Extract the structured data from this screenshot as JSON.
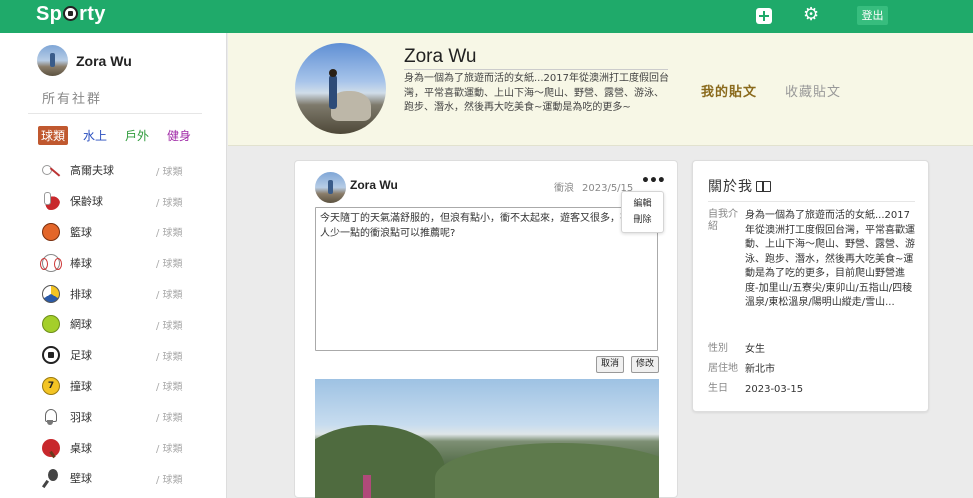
{
  "app": {
    "logo_text_a": "Sp",
    "logo_text_b": "rty",
    "logout_label": "登出"
  },
  "sidebar": {
    "username": "Zora Wu",
    "heading": "所有社群",
    "category_tabs": [
      {
        "label": "球類",
        "active": true
      },
      {
        "label": "水上",
        "active": false
      },
      {
        "label": "戶外",
        "active": false
      },
      {
        "label": "健身",
        "active": false
      }
    ],
    "sports": [
      {
        "name": "高爾夫球",
        "category": "/ 球類",
        "icon": "golf-icon"
      },
      {
        "name": "保齡球",
        "category": "/ 球類",
        "icon": "bowling-icon"
      },
      {
        "name": "籃球",
        "category": "/ 球類",
        "icon": "basketball-icon"
      },
      {
        "name": "棒球",
        "category": "/ 球類",
        "icon": "baseball-icon"
      },
      {
        "name": "排球",
        "category": "/ 球類",
        "icon": "volleyball-icon"
      },
      {
        "name": "網球",
        "category": "/ 球類",
        "icon": "tennis-icon"
      },
      {
        "name": "足球",
        "category": "/ 球類",
        "icon": "soccer-icon"
      },
      {
        "name": "撞球",
        "category": "/ 球類",
        "icon": "billiards-icon"
      },
      {
        "name": "羽球",
        "category": "/ 球類",
        "icon": "badminton-icon"
      },
      {
        "name": "桌球",
        "category": "/ 球類",
        "icon": "table-tennis-icon"
      },
      {
        "name": "壁球",
        "category": "/ 球類",
        "icon": "squash-icon"
      }
    ]
  },
  "profile": {
    "name": "Zora Wu",
    "bio": "身為一個為了旅遊而活的女紙...2017年從澳洲打工度假回台灣，平常喜歡運動、上山下海～爬山、野營、露營、游泳、跑步、潛水，然後再大吃美食~運動是為吃的更多~",
    "tab_mine": "我的貼文",
    "tab_saved": "收藏貼文"
  },
  "post": {
    "author": "Zora Wu",
    "tag": "衝浪",
    "date": "2023/5/15",
    "more": "•••",
    "menu_edit": "編輯",
    "menu_delete": "刪除",
    "content": "今天隨丁的天氣滿舒服的，但浪有點小，衝不太起來，遊客又很多，有附近人少一點的衝浪點可以推薦呢?",
    "cancel_label": "取消",
    "edit_label": "修改"
  },
  "about": {
    "title": "關於我",
    "bio_label": "自我介紹",
    "bio": "身為一個為了旅遊而活的女紙...2017年從澳洲打工度假回台灣，平常喜歡運動、上山下海～爬山、野營、露營、游泳、跑步、潛水，然後再大吃美食~運動是為了吃的更多，目前爬山野營進度-加里山/五寮尖/東卯山/五指山/四稜溫泉/東松溫泉/陽明山縱走/雪山...",
    "gender_label": "性別",
    "gender": "女生",
    "city_label": "居住地",
    "city": "新北市",
    "birth_label": "生日",
    "birth": "2023-03-15"
  },
  "colors": {
    "brand": "#1faa6a",
    "active_tab": "#c0582f",
    "tab_mine": "#8a6a1c"
  }
}
